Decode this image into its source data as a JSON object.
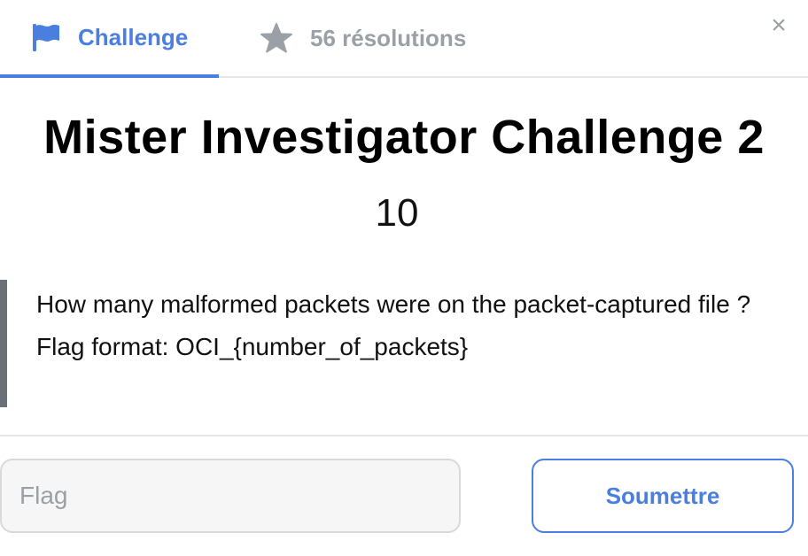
{
  "tabs": {
    "challenge": {
      "label": "Challenge",
      "icon": "flag-icon",
      "color": "#4a7fe0",
      "active": true
    },
    "solves": {
      "label": "56 résolutions",
      "icon": "star-icon",
      "color": "#9aa0a6"
    }
  },
  "close": {
    "icon": "close-icon",
    "glyph": "×"
  },
  "challenge": {
    "title": "Mister Investigator Challenge 2",
    "points": "10",
    "description": [
      "How many malformed packets were on the packet-captured file ?",
      "Flag format: OCI_{number_of_packets}"
    ]
  },
  "form": {
    "flag_placeholder": "Flag",
    "flag_value": "",
    "submit_label": "Soumettre"
  },
  "colors": {
    "accent": "#4a7fe0",
    "muted": "#9aa0a6",
    "quote_bar": "#6b6f76"
  }
}
